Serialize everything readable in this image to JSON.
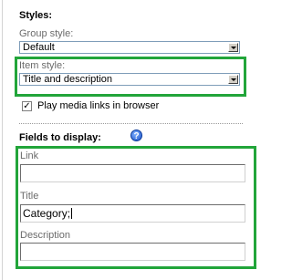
{
  "styles": {
    "heading": "Styles:",
    "group_style": {
      "label": "Group style:",
      "value": "Default"
    },
    "item_style": {
      "label": "Item style:",
      "value": "Title and description"
    },
    "play_media": {
      "label": "Play media links in browser",
      "checked": true
    }
  },
  "fields": {
    "heading": "Fields to display:",
    "help_icon": "question-mark-icon",
    "link": {
      "label": "Link",
      "value": ""
    },
    "title": {
      "label": "Title",
      "value": "Category;"
    },
    "description": {
      "label": "Description",
      "value": ""
    }
  },
  "colors": {
    "highlight": "#22a53a",
    "help_icon": "#1c52c7"
  }
}
